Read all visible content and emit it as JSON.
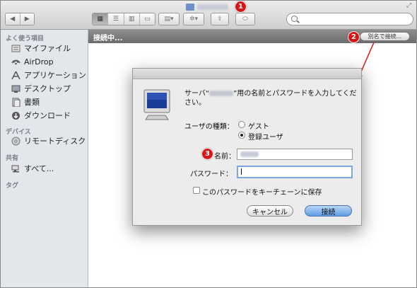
{
  "window": {
    "title_blurred": true
  },
  "callouts": {
    "one": "1",
    "two": "2",
    "three": "3"
  },
  "sidebar": {
    "favorites_header": "よく使う項目",
    "favorites": [
      {
        "label": "マイファイル",
        "icon": "all-files-icon"
      },
      {
        "label": "AirDrop",
        "icon": "airdrop-icon"
      },
      {
        "label": "アプリケーション",
        "icon": "applications-icon"
      },
      {
        "label": "デスクトップ",
        "icon": "desktop-icon"
      },
      {
        "label": "書類",
        "icon": "documents-icon"
      },
      {
        "label": "ダウンロード",
        "icon": "downloads-icon"
      }
    ],
    "devices_header": "デバイス",
    "devices": [
      {
        "label": "リモートディスク",
        "icon": "remote-disc-icon"
      }
    ],
    "shared_header": "共有",
    "shared": [
      {
        "label": "すべて...",
        "icon": "network-icon"
      }
    ],
    "tags_header": "タグ"
  },
  "content": {
    "status": "接続中...",
    "connect_as_button": "別名で接続..."
  },
  "dialog": {
    "message_prefix": "サーバ“",
    "message_suffix": "”用の名前とパスワードを入力してください。",
    "user_type_label": "ユーザの種類：",
    "guest_option": "ゲスト",
    "registered_option": "登録ユーザ",
    "selected_user_type": "registered",
    "name_label": "名前：",
    "name_value": "",
    "password_label": "パスワード：",
    "password_value": "",
    "keychain_checkbox_label": "このパスワードをキーチェーンに保存",
    "keychain_checked": false,
    "cancel_button": "キャンセル",
    "connect_button": "接続"
  },
  "colors": {
    "callout": "#d71515",
    "default_button": "#5f9de5",
    "content_bar": "#7a7a7a",
    "sidebar_bg": "#e3e7ec"
  }
}
